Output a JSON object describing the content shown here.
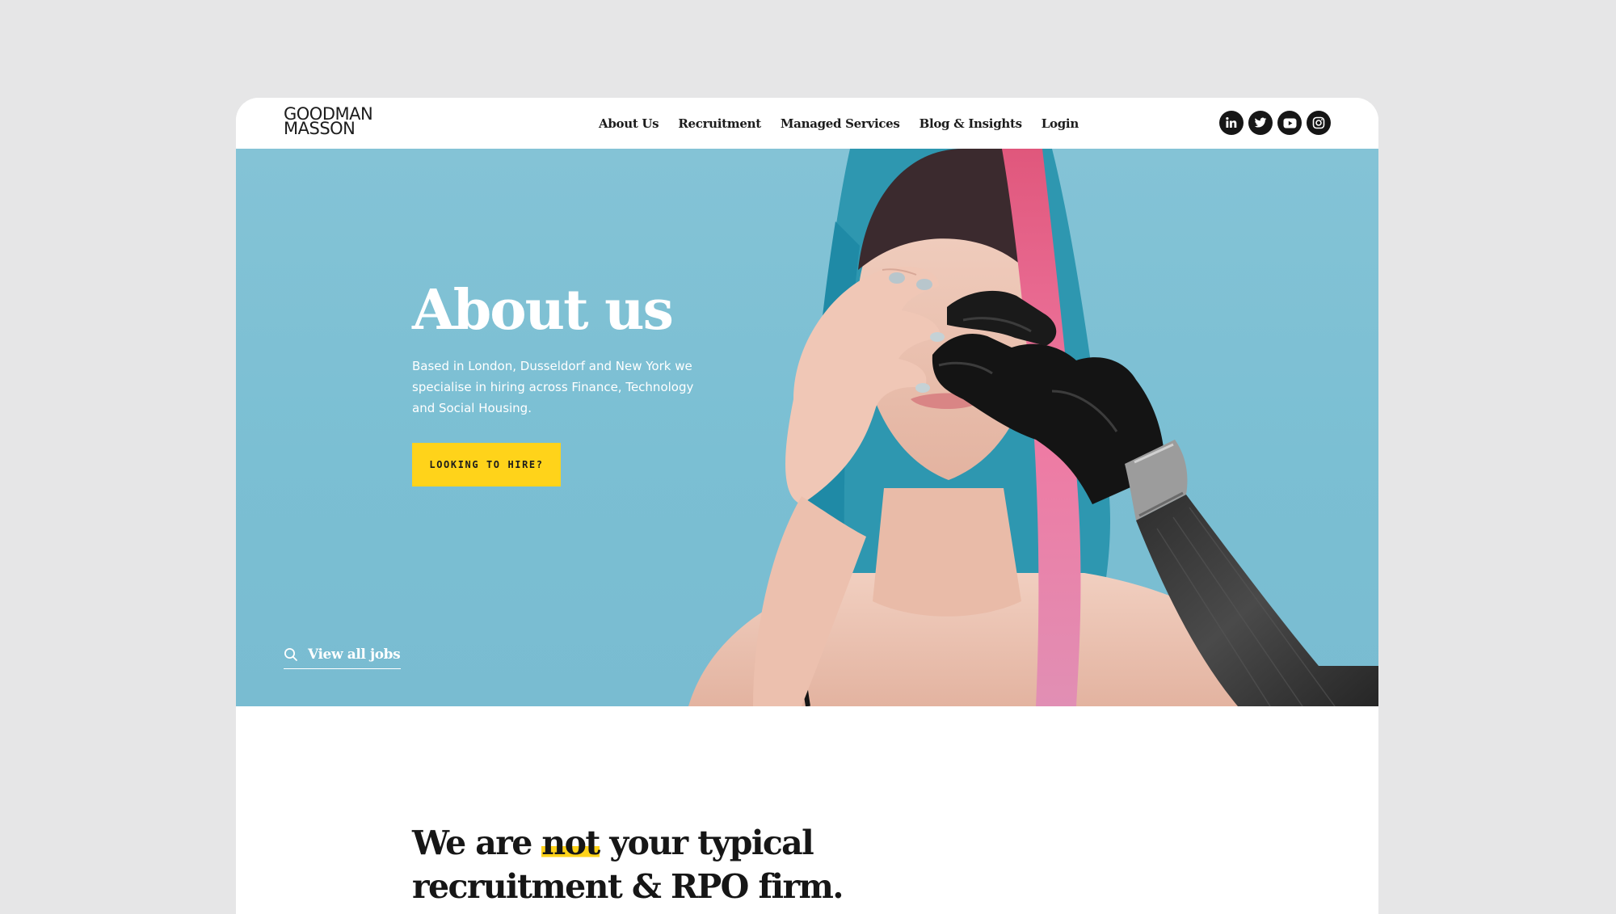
{
  "logo": {
    "line1": "GOODMAN",
    "line2": "MASSON"
  },
  "nav": {
    "items": [
      {
        "label": "About Us"
      },
      {
        "label": "Recruitment"
      },
      {
        "label": "Managed Services"
      },
      {
        "label": "Blog & Insights"
      },
      {
        "label": "Login"
      }
    ]
  },
  "social": [
    {
      "icon": "linkedin-icon"
    },
    {
      "icon": "twitter-icon"
    },
    {
      "icon": "youtube-icon"
    },
    {
      "icon": "instagram-icon"
    }
  ],
  "hero": {
    "title": "About us",
    "text": "Based in London, Dusseldorf and New York we specialise in hiring across Finance, Technology and Social Housing.",
    "cta": "LOOKING TO HIRE?",
    "view_jobs": "View all jobs",
    "background_color": "#7bbfd3"
  },
  "intro": {
    "before": "We are ",
    "highlight": "not",
    "after": " your typical",
    "line2": "recruitment & RPO firm."
  },
  "colors": {
    "accent": "#ffd31a",
    "dark": "#161616",
    "page_background": "#e6e6e7"
  }
}
